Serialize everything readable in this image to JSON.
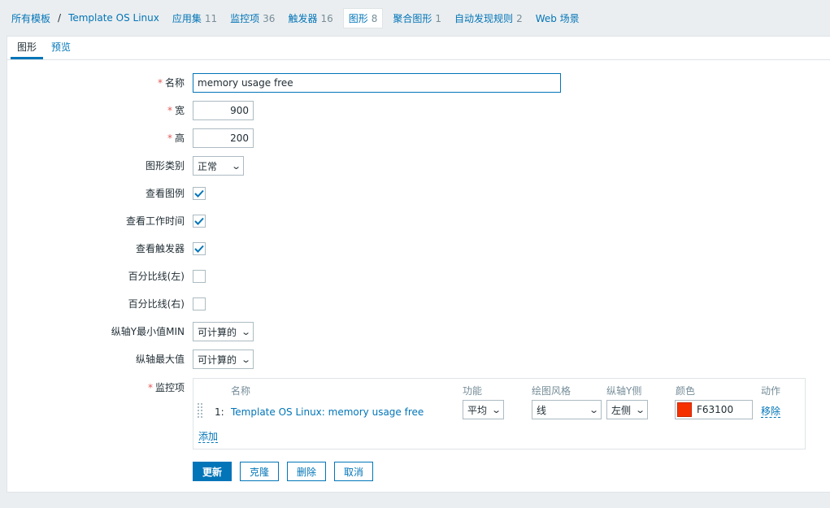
{
  "breadcrumb": {
    "all_templates": "所有模板",
    "separator": "/",
    "template": "Template OS Linux",
    "tabs": [
      {
        "label": "应用集",
        "count": "11"
      },
      {
        "label": "监控项",
        "count": "36"
      },
      {
        "label": "触发器",
        "count": "16"
      },
      {
        "label": "图形",
        "count": "8"
      },
      {
        "label": "聚合图形",
        "count": "1"
      },
      {
        "label": "自动发现规则",
        "count": "2"
      },
      {
        "label": "Web 场景",
        "count": ""
      }
    ]
  },
  "tabs": {
    "graph": "图形",
    "preview": "预览"
  },
  "form": {
    "required_mark": "*",
    "name_label": "名称",
    "name_value": "memory usage free",
    "width_label": "宽",
    "width_value": "900",
    "height_label": "高",
    "height_value": "200",
    "graph_type_label": "图形类别",
    "graph_type_value": "正常",
    "show_legend_label": "查看图例",
    "show_legend": true,
    "show_working_time_label": "查看工作时间",
    "show_working_time": true,
    "show_triggers_label": "查看触发器",
    "show_triggers": true,
    "percentile_left_label": "百分比线(左)",
    "percentile_left": false,
    "percentile_right_label": "百分比线(右)",
    "percentile_right": false,
    "y_min_label": "纵轴Y最小值MIN",
    "y_min_value": "可计算的",
    "y_max_label": "纵轴最大值",
    "y_max_value": "可计算的",
    "items_label": "监控项"
  },
  "items_table": {
    "headers": {
      "name": "名称",
      "function": "功能",
      "draw_style": "绘图风格",
      "y_axis_side": "纵轴Y侧",
      "color": "颜色",
      "action": "动作"
    },
    "rows": [
      {
        "index": "1:",
        "name": "Template OS Linux: memory usage free",
        "function": "平均",
        "draw_style": "线",
        "y_axis_side": "左侧",
        "color": "F63100",
        "color_hex": "#f63100",
        "remove": "移除"
      }
    ],
    "add": "添加"
  },
  "buttons": {
    "update": "更新",
    "clone": "克隆",
    "delete": "删除",
    "cancel": "取消"
  }
}
